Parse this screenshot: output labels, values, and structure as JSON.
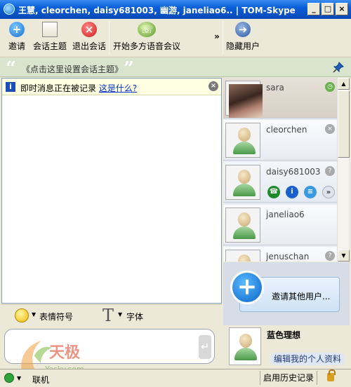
{
  "window": {
    "title": "王慧, cleorchen, daisy681003, 幽游, janeliao6.. | TOM-Skype (TM) (BETA..",
    "controls": [
      "_",
      "□",
      "×"
    ]
  },
  "toolbar": {
    "invite": "邀请",
    "topic": "会话主题",
    "leave": "退出会话",
    "conference": "开始多方语音会议",
    "more": "»",
    "hide_users": "隐藏用户"
  },
  "topic_bar": {
    "open_quote": "“",
    "text": "《点击这里设置会话主题》",
    "close_quote": "”"
  },
  "notice": {
    "text": "即时消息正在被记录",
    "link": "这是什么?"
  },
  "contacts": [
    {
      "name": "sara"
    },
    {
      "name": "cleorchen"
    },
    {
      "name": "daisy681003"
    },
    {
      "name": "janeliao6"
    },
    {
      "name": "jenuschan"
    }
  ],
  "invite_others": "邀请其他用户...",
  "emote_bar": {
    "emoticons": "表情符号",
    "font": "字体"
  },
  "me": {
    "name": "蓝色理想",
    "edit_profile": "编辑我的个人资料"
  },
  "status": {
    "online_label": "联机",
    "history": "启用历史记录"
  },
  "watermark": {
    "text": "天极",
    "sub": "Yesky.com"
  },
  "colors": {
    "titlebar": "#0a5fd8",
    "topic_bg": "#d9e4cf",
    "notice_bg": "#ffffe1",
    "online": "#2ea43a"
  }
}
